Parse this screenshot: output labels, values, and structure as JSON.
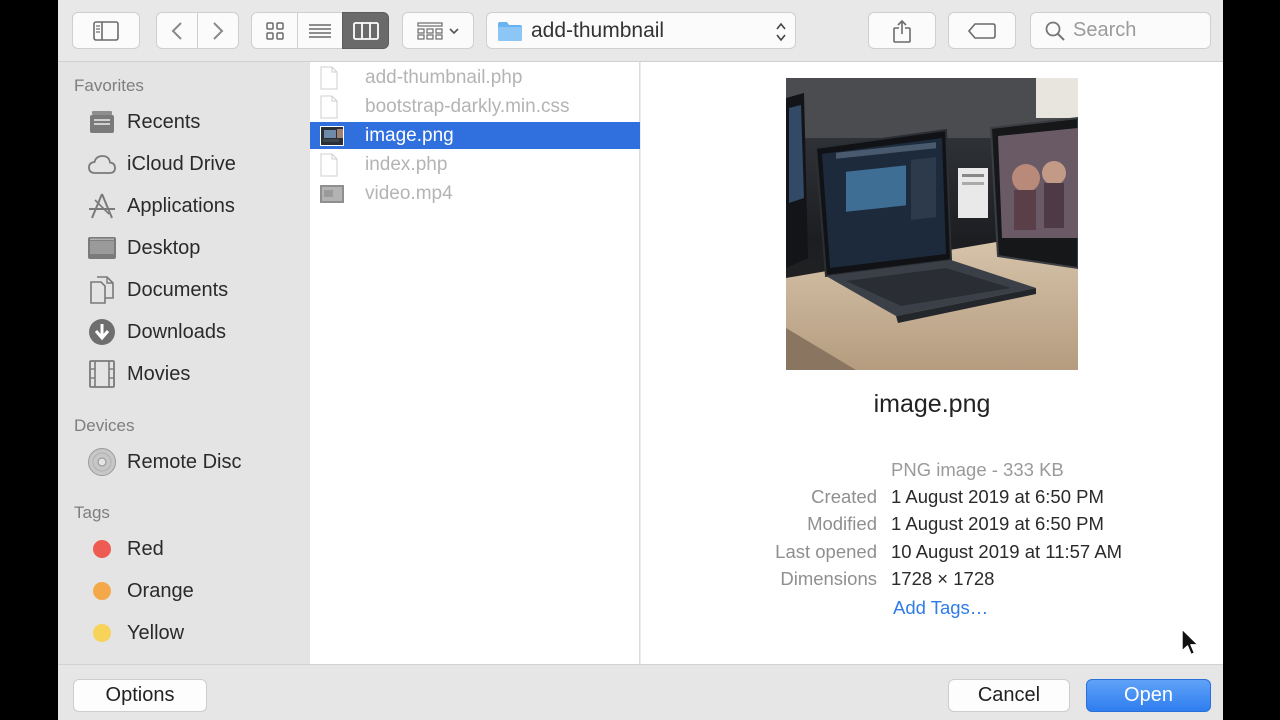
{
  "toolbar": {
    "path_label": "add-thumbnail",
    "search_placeholder": "Search"
  },
  "sidebar": {
    "favorites_heading": "Favorites",
    "favorites": [
      {
        "label": "Recents",
        "icon": "recents-icon"
      },
      {
        "label": "iCloud Drive",
        "icon": "cloud-icon"
      },
      {
        "label": "Applications",
        "icon": "applications-icon"
      },
      {
        "label": "Desktop",
        "icon": "desktop-icon"
      },
      {
        "label": "Documents",
        "icon": "documents-icon"
      },
      {
        "label": "Downloads",
        "icon": "downloads-icon"
      },
      {
        "label": "Movies",
        "icon": "movies-icon"
      }
    ],
    "devices_heading": "Devices",
    "devices": [
      {
        "label": "Remote Disc",
        "icon": "disc-icon"
      }
    ],
    "tags_heading": "Tags",
    "tags": [
      {
        "label": "Red",
        "color": "#ee5b52"
      },
      {
        "label": "Orange",
        "color": "#f5a84a"
      },
      {
        "label": "Yellow",
        "color": "#f7d35a"
      }
    ]
  },
  "files": [
    {
      "name": "add-thumbnail.php",
      "icon": "document-icon",
      "selected": false
    },
    {
      "name": "bootstrap-darkly.min.css",
      "icon": "document-icon",
      "selected": false
    },
    {
      "name": "image.png",
      "icon": "image-thumbnail-icon",
      "selected": true
    },
    {
      "name": "index.php",
      "icon": "document-icon",
      "selected": false
    },
    {
      "name": "video.mp4",
      "icon": "video-thumbnail-icon",
      "selected": false
    }
  ],
  "preview": {
    "name": "image.png",
    "kind_size": "PNG image - 333 KB",
    "info": [
      {
        "key": "Created",
        "value": "1 August 2019 at 6:50 PM"
      },
      {
        "key": "Modified",
        "value": "1 August 2019 at 6:50 PM"
      },
      {
        "key": "Last opened",
        "value": "10 August 2019 at 11:57 AM"
      },
      {
        "key": "Dimensions",
        "value": "1728 × 1728"
      }
    ],
    "add_tags": "Add Tags…"
  },
  "buttons": {
    "options": "Options",
    "cancel": "Cancel",
    "open": "Open"
  },
  "colors": {
    "selection": "#2f6fde",
    "link": "#2f7ce8",
    "accent_button": "#2f7ef0"
  }
}
